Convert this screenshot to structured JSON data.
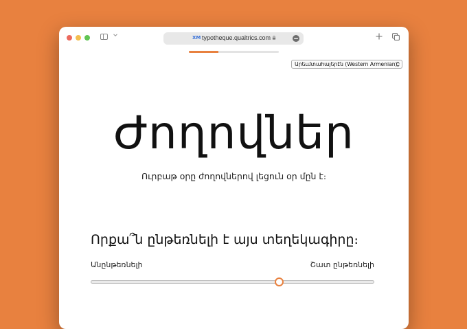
{
  "browser": {
    "url": "typotheque.qualtrics.com",
    "site_icon": "XM",
    "icons": [
      "sidebar-icon",
      "chevron-down-icon",
      "lock-icon",
      "more-icon",
      "plus-icon",
      "tabs-icon"
    ]
  },
  "survey": {
    "progress_fraction": 0.33,
    "language_select": "Արեւմտահայերէն (Western Armenian)",
    "specimen_word": "Ժողովներ",
    "specimen_sentence": "Ուրբաթ օրը ժողովներով լեցուն օր մըն է։",
    "question": "Որքա՞ն ընթեռնելի է այս տեղեկագիրը։",
    "slider": {
      "min_label": "Անընթեռնելի",
      "max_label": "Շատ ընթեռնելի",
      "value_fraction": 0.665
    }
  },
  "colors": {
    "background": "#e8813f",
    "accent": "#e8813f"
  }
}
